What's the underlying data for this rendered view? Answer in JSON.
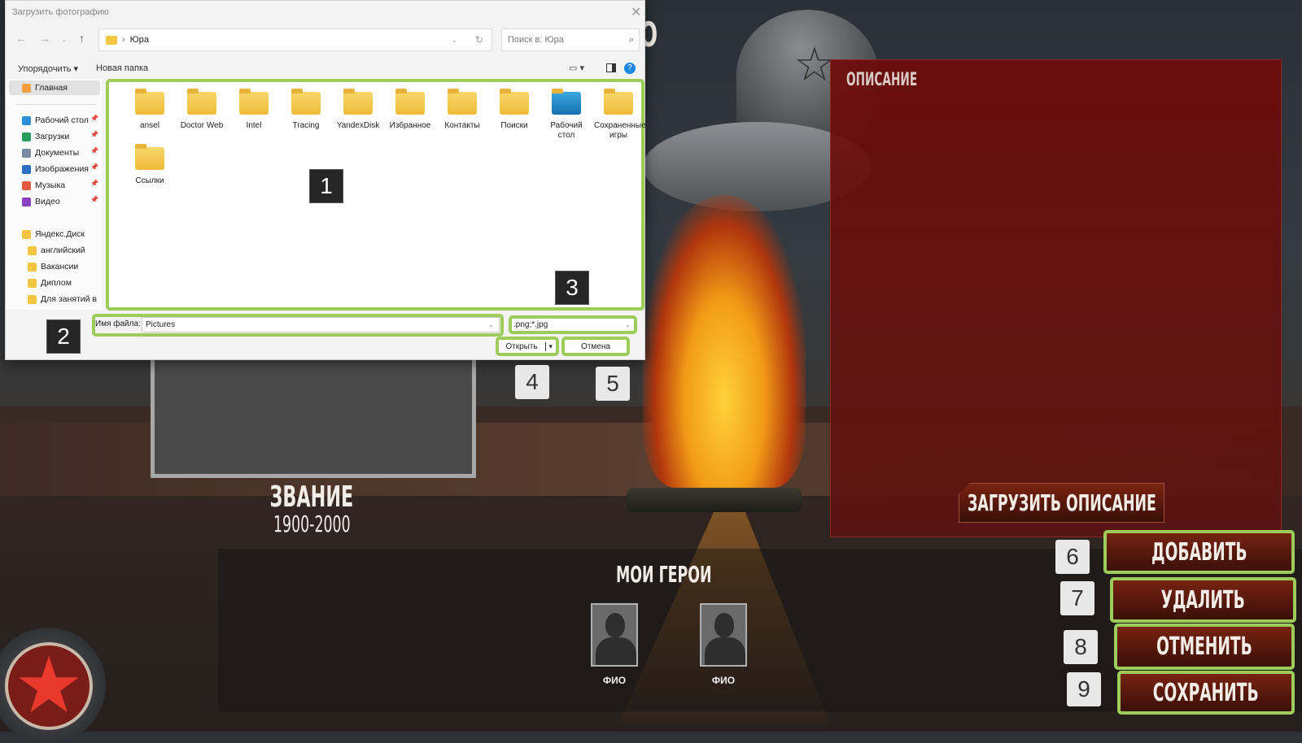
{
  "game": {
    "title_fragment": "ФИО",
    "rank": "ЗВАНИЕ",
    "years": "1900-2000",
    "description_label": "ОПИСАНИЕ",
    "load_description": "ЗАГРУЗИТЬ ОПИСАНИЕ",
    "heroes_title": "МОИ ГЕРОИ",
    "heroes": [
      {
        "label": "ФИО"
      },
      {
        "label": "ФИО"
      }
    ],
    "buttons": {
      "add": "ДОБАВИТЬ",
      "delete": "УДАЛИТЬ",
      "cancel": "ОТМЕНИТЬ",
      "save": "СОХРАНИТЬ"
    },
    "emblem_icon": "red-star",
    "highlight_color": "#9dcc5a",
    "panel_color": "#6e0a08"
  },
  "annotations": [
    "1",
    "2",
    "3",
    "4",
    "5",
    "6",
    "7",
    "8",
    "9"
  ],
  "dialog": {
    "title": "Загрузить фотографию",
    "address": "Юра",
    "search_placeholder": "Поиск в: Юра",
    "toolbar": {
      "organize": "Упорядочить ▾",
      "new_folder": "Новая папка"
    },
    "sidebar": [
      {
        "label": "Главная",
        "icon": "home",
        "selected": true
      },
      {
        "label": "Рабочий стол",
        "icon": "desktop",
        "pinned": true
      },
      {
        "label": "Загрузки",
        "icon": "download",
        "pinned": true
      },
      {
        "label": "Документы",
        "icon": "document",
        "pinned": true
      },
      {
        "label": "Изображения",
        "icon": "image",
        "pinned": true
      },
      {
        "label": "Музыка",
        "icon": "music",
        "pinned": true
      },
      {
        "label": "Видео",
        "icon": "video",
        "pinned": true
      },
      {
        "label": "Яндекс.Диск",
        "icon": "yandex-disk"
      },
      {
        "label": "английский",
        "icon": "synced-folder"
      },
      {
        "label": "Вакансии",
        "icon": "synced-folder"
      },
      {
        "label": "Диплом",
        "icon": "synced-folder"
      },
      {
        "label": "Для занятий в",
        "icon": "synced-folder"
      }
    ],
    "files": [
      "ansel",
      "Doctor Web",
      "Intel",
      "Tracing",
      "YandexDisk",
      "Избранное",
      "Контакты",
      "Поиски",
      "Рабочий стол",
      "Сохраненные игры",
      "Ссылки"
    ],
    "filename_label": "Имя файла:",
    "filename_value": "Pictures",
    "filter_value": ".png;*.jpg",
    "open_label": "Открыть",
    "cancel_label": "Отмена"
  }
}
